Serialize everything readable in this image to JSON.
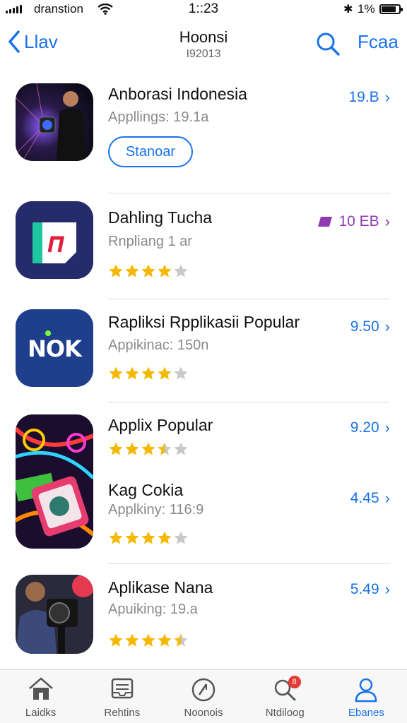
{
  "status_bar": {
    "carrier": "dranstion",
    "time": "1::23",
    "battery_text": "1%",
    "battery_level": 0.85
  },
  "nav": {
    "back_label": "Llav",
    "title": "Hoonsi",
    "subtitle": "I92013",
    "right_label": "Fcaa"
  },
  "apps": [
    {
      "name": "Anborasi Indonesia",
      "subtitle": "Appllings: 19.1a",
      "price": "19.B",
      "button": "Stanoar"
    },
    {
      "name": "Dahling Tucha",
      "subtitle": "Rnpliang 1 ar",
      "price": "10 EB",
      "rating": 4,
      "tag_color": "#8e3ab0"
    },
    {
      "name": "Rapliksi Rpplikasii Popular",
      "subtitle": "Appikinac: 150n",
      "price": "9.50",
      "rating": 4
    },
    {
      "name": "Applix Popular",
      "price": "9.20",
      "rating": 3.5
    },
    {
      "name": "Kag Cokia",
      "subtitle": "Applkiny: 116:9",
      "price": "4.45",
      "rating": 4
    },
    {
      "name": "Aplikase Nana",
      "subtitle": "Apuiking: 19.a",
      "price": "5.49",
      "rating": 4.5
    }
  ],
  "icon_texts": {
    "nok": "NOK"
  },
  "tabs": [
    {
      "label": "Laidks",
      "icon": "home-icon"
    },
    {
      "label": "Rehtins",
      "icon": "tray-icon"
    },
    {
      "label": "Noonois",
      "icon": "compass-icon"
    },
    {
      "label": "Ntdiloog",
      "icon": "search-icon",
      "badge": "8"
    },
    {
      "label": "Ebanes",
      "icon": "person-icon",
      "active": true
    }
  ],
  "colors": {
    "accent": "#1a73e8",
    "star": "#f5b800",
    "star_empty": "#c8c8c8"
  }
}
